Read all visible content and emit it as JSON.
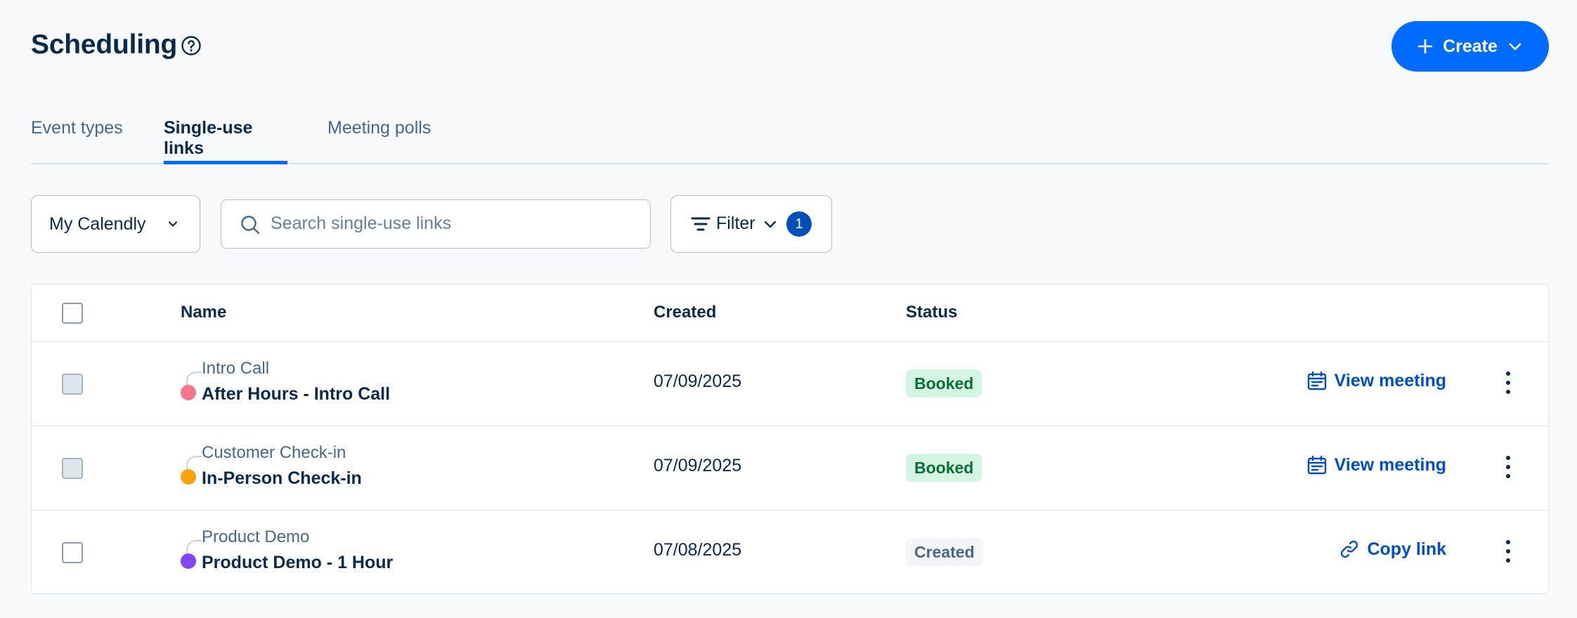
{
  "header": {
    "title": "Scheduling",
    "create_label": "Create"
  },
  "tabs": [
    {
      "label": "Event types",
      "active": false
    },
    {
      "label": "Single-use links",
      "active": true
    },
    {
      "label": "Meeting polls",
      "active": false
    }
  ],
  "controls": {
    "calendar_select": "My Calendly",
    "search_placeholder": "Search single-use links",
    "filter_label": "Filter",
    "filter_count": "1"
  },
  "table": {
    "columns": [
      "Name",
      "Created",
      "Status"
    ],
    "rows": [
      {
        "event_type": "Intro Call",
        "name": "After Hours - Intro Call",
        "color": "#f4768a",
        "created": "07/09/2025",
        "status": "Booked",
        "action": "View meeting",
        "action_icon": "calendar-icon"
      },
      {
        "event_type": "Customer Check-in",
        "name": "In-Person Check-in",
        "color": "#f5a20c",
        "created": "07/09/2025",
        "status": "Booked",
        "action": "View meeting",
        "action_icon": "calendar-icon"
      },
      {
        "event_type": "Product Demo",
        "name": "Product Demo - 1 Hour",
        "color": "#8247f5",
        "created": "07/08/2025",
        "status": "Created",
        "action": "Copy link",
        "action_icon": "link-icon"
      }
    ]
  },
  "colors": {
    "accent": "#006bff",
    "booked_bg": "#d5f5e3",
    "booked_text": "#0a6e35"
  }
}
